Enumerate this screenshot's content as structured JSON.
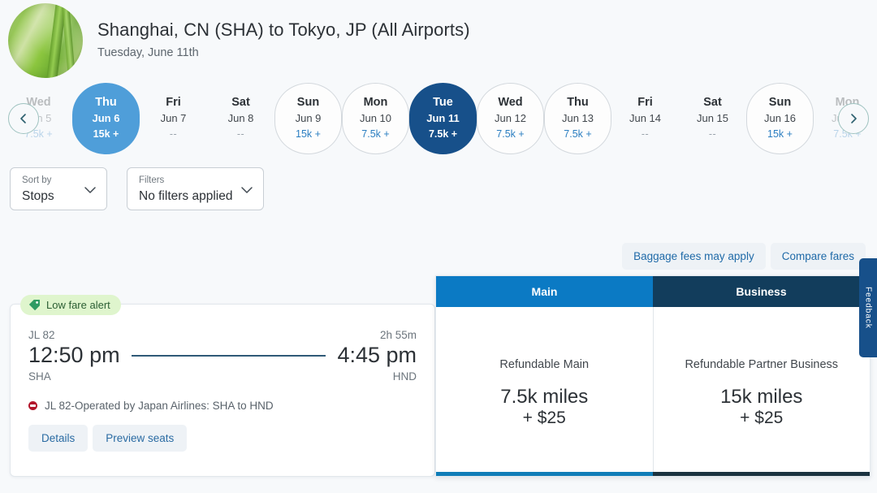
{
  "header": {
    "route_title": "Shanghai, CN (SHA) to Tokyo, JP (All Airports)",
    "date_label": "Tuesday, June 11th",
    "avatar_name": "bamboo-photo"
  },
  "carousel": {
    "prev_label": "‹",
    "next_label": "›",
    "dates": [
      {
        "dow": "Wed",
        "date": "Jun 5",
        "miles": "7.5k +",
        "state": "faded"
      },
      {
        "dow": "Thu",
        "date": "Jun 6",
        "miles": "15k +",
        "state": "selected-light"
      },
      {
        "dow": "Fri",
        "date": "Jun 7",
        "miles": "--",
        "state": "plain"
      },
      {
        "dow": "Sat",
        "date": "Jun 8",
        "miles": "--",
        "state": "plain"
      },
      {
        "dow": "Sun",
        "date": "Jun 9",
        "miles": "15k +",
        "state": "outlined"
      },
      {
        "dow": "Mon",
        "date": "Jun 10",
        "miles": "7.5k +",
        "state": "outlined"
      },
      {
        "dow": "Tue",
        "date": "Jun 11",
        "miles": "7.5k +",
        "state": "selected-dark"
      },
      {
        "dow": "Wed",
        "date": "Jun 12",
        "miles": "7.5k +",
        "state": "outlined"
      },
      {
        "dow": "Thu",
        "date": "Jun 13",
        "miles": "7.5k +",
        "state": "outlined"
      },
      {
        "dow": "Fri",
        "date": "Jun 14",
        "miles": "--",
        "state": "plain"
      },
      {
        "dow": "Sat",
        "date": "Jun 15",
        "miles": "--",
        "state": "plain"
      },
      {
        "dow": "Sun",
        "date": "Jun 16",
        "miles": "15k +",
        "state": "outlined"
      },
      {
        "dow": "Mon",
        "date": "Jun 17",
        "miles": "7.5k +",
        "state": "faded"
      }
    ]
  },
  "controls": {
    "sort": {
      "label": "Sort by",
      "value": "Stops"
    },
    "filters": {
      "label": "Filters",
      "value": "No filters applied"
    }
  },
  "utility": {
    "baggage": "Baggage fees may apply",
    "compare": "Compare fares"
  },
  "flight": {
    "badge": "Low fare alert",
    "flight_number": "JL 82",
    "duration": "2h 55m",
    "depart_time": "12:50 pm",
    "arrive_time": "4:45 pm",
    "origin": "SHA",
    "destination": "HND",
    "operated_by": "JL 82-Operated by Japan Airlines: SHA to HND",
    "details_label": "Details",
    "preview_label": "Preview seats"
  },
  "fares": {
    "tabs": [
      {
        "label": "Main",
        "color": "#0b7ac4"
      },
      {
        "label": "Business",
        "color": "#123d5c"
      }
    ],
    "options": [
      {
        "name": "Refundable Main",
        "miles": "7.5k miles",
        "fee": "+ $25"
      },
      {
        "name": "Refundable Partner Business",
        "miles": "15k miles",
        "fee": "+ $25"
      }
    ]
  },
  "feedback": {
    "label": "Feedback"
  },
  "colors": {
    "selected_dark": "#17508a",
    "selected_light": "#4f9ed9",
    "tab_main": "#0b7ac4",
    "tab_business": "#123d5c",
    "link_blue": "#2b7ec1",
    "badge_green_bg": "#dff5cd",
    "badge_green_text": "#2b5e33",
    "page_bg": "#f7f9fb"
  }
}
